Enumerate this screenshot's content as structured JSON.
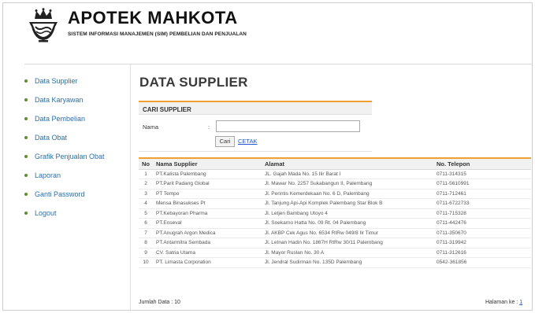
{
  "header": {
    "title": "APOTEK MAHKOTA",
    "subtitle": "SISTEM INFORMASI MANAJEMEN (SIM) PEMBELIAN DAN PENJUALAN"
  },
  "sidebar": {
    "items": [
      {
        "label": "Data Supplier"
      },
      {
        "label": "Data Karyawan"
      },
      {
        "label": "Data Pembelian"
      },
      {
        "label": "Data Obat"
      },
      {
        "label": "Grafik Penjualan Obat"
      },
      {
        "label": "Laporan"
      },
      {
        "label": "Ganti Password"
      },
      {
        "label": "Logout"
      }
    ]
  },
  "main": {
    "title": "DATA SUPPLIER",
    "search": {
      "heading": "CARI SUPPLIER",
      "label": "Nama",
      "colon": ":",
      "value": "",
      "button": "Cari",
      "print_link": "CETAK"
    },
    "table": {
      "headers": [
        "No",
        "Nama Supplier",
        "Alamat",
        "No. Telepon"
      ],
      "rows": [
        {
          "no": "1",
          "nama": "PT.Kalista Palembang",
          "alamat": "JL. Gajah Mada No. 15 Ilir Barat I",
          "telp": "0711-314315"
        },
        {
          "no": "2",
          "nama": "PT.Parit Padang Global",
          "alamat": "Jl. Mawar No. 2257 Sukabangun II, Palembang",
          "telp": "0711-5610991"
        },
        {
          "no": "3",
          "nama": "PT Tempo",
          "alamat": "Jl. Perintis Kemerdekaan No. 6 D, Palembang",
          "telp": "0711-712461"
        },
        {
          "no": "4",
          "nama": "Mensa Binasukses Pt",
          "alamat": "Jl. Tanjung Api-Api Komplek Palembang Star Blok B",
          "telp": "0711-6722733"
        },
        {
          "no": "5",
          "nama": "PT.Kebayoran Pharma",
          "alamat": "Jl. Letjen Bambang Utoyo 4",
          "telp": "0711-715328"
        },
        {
          "no": "6",
          "nama": "PT.Enseval",
          "alamat": "Jl. Soekarno Hatta No. 09 Rt. 04 Palembang",
          "telp": "0711-442476"
        },
        {
          "no": "7",
          "nama": "PT.Anugrah Argon Medica",
          "alamat": "Jl. AKBP Cek Agus No. 6534 RtRw 049/8 Ilr Timur",
          "telp": "0711-350670"
        },
        {
          "no": "8",
          "nama": "PT.Antarmitra Sembada",
          "alamat": "Jl. Letnan Hadin No. 1867H RtRw 30/11 Palembang",
          "telp": "0711-319942"
        },
        {
          "no": "9",
          "nama": "CV. Satria Utama",
          "alamat": "Jl. Mayor Ruslan No. 30 A",
          "telp": "0711-312616"
        },
        {
          "no": "10",
          "nama": "PT. Limasta Corporation",
          "alamat": "Jl. Jendral Sudirman No. 135D Palembang",
          "telp": "0542-361856"
        }
      ]
    },
    "footer": {
      "count": "Jumlah Data : 10",
      "page_label": "Halaman ke :",
      "page_number": "1"
    }
  },
  "colors": {
    "accent": "#f0a030",
    "link": "#2a6fb0",
    "bullet": "#5b8f2a"
  },
  "icons": {
    "logo": "mortar-pestle-crown-logo",
    "bullet": "bullet-dot-icon"
  }
}
